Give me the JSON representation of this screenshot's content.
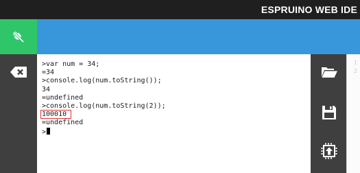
{
  "app": {
    "title": "ESPRUINO WEB IDE"
  },
  "terminal": {
    "lines": [
      ">var num = 34;",
      "=34",
      ">console.log(num.toString());",
      "34",
      "=undefined",
      ">console.log(num.toString(2));",
      "100010",
      "=undefined",
      ">"
    ],
    "highlighted_line": 6
  },
  "editor": {
    "gutter_lines": [
      "1",
      "2"
    ]
  },
  "colors": {
    "titlebar": "#1f1f1f",
    "connect_button": "#2fc66a",
    "toolbar": "#3797da",
    "sidebar": "#3f3f3f",
    "terminal_bg": "#ffffff",
    "highlight_border": "#e03030"
  },
  "icons": {
    "connect": "plug-disconnected-icon",
    "clear": "backspace-clear-icon",
    "open": "folder-open-icon",
    "save": "floppy-disk-icon",
    "upload": "upload-chip-icon"
  }
}
